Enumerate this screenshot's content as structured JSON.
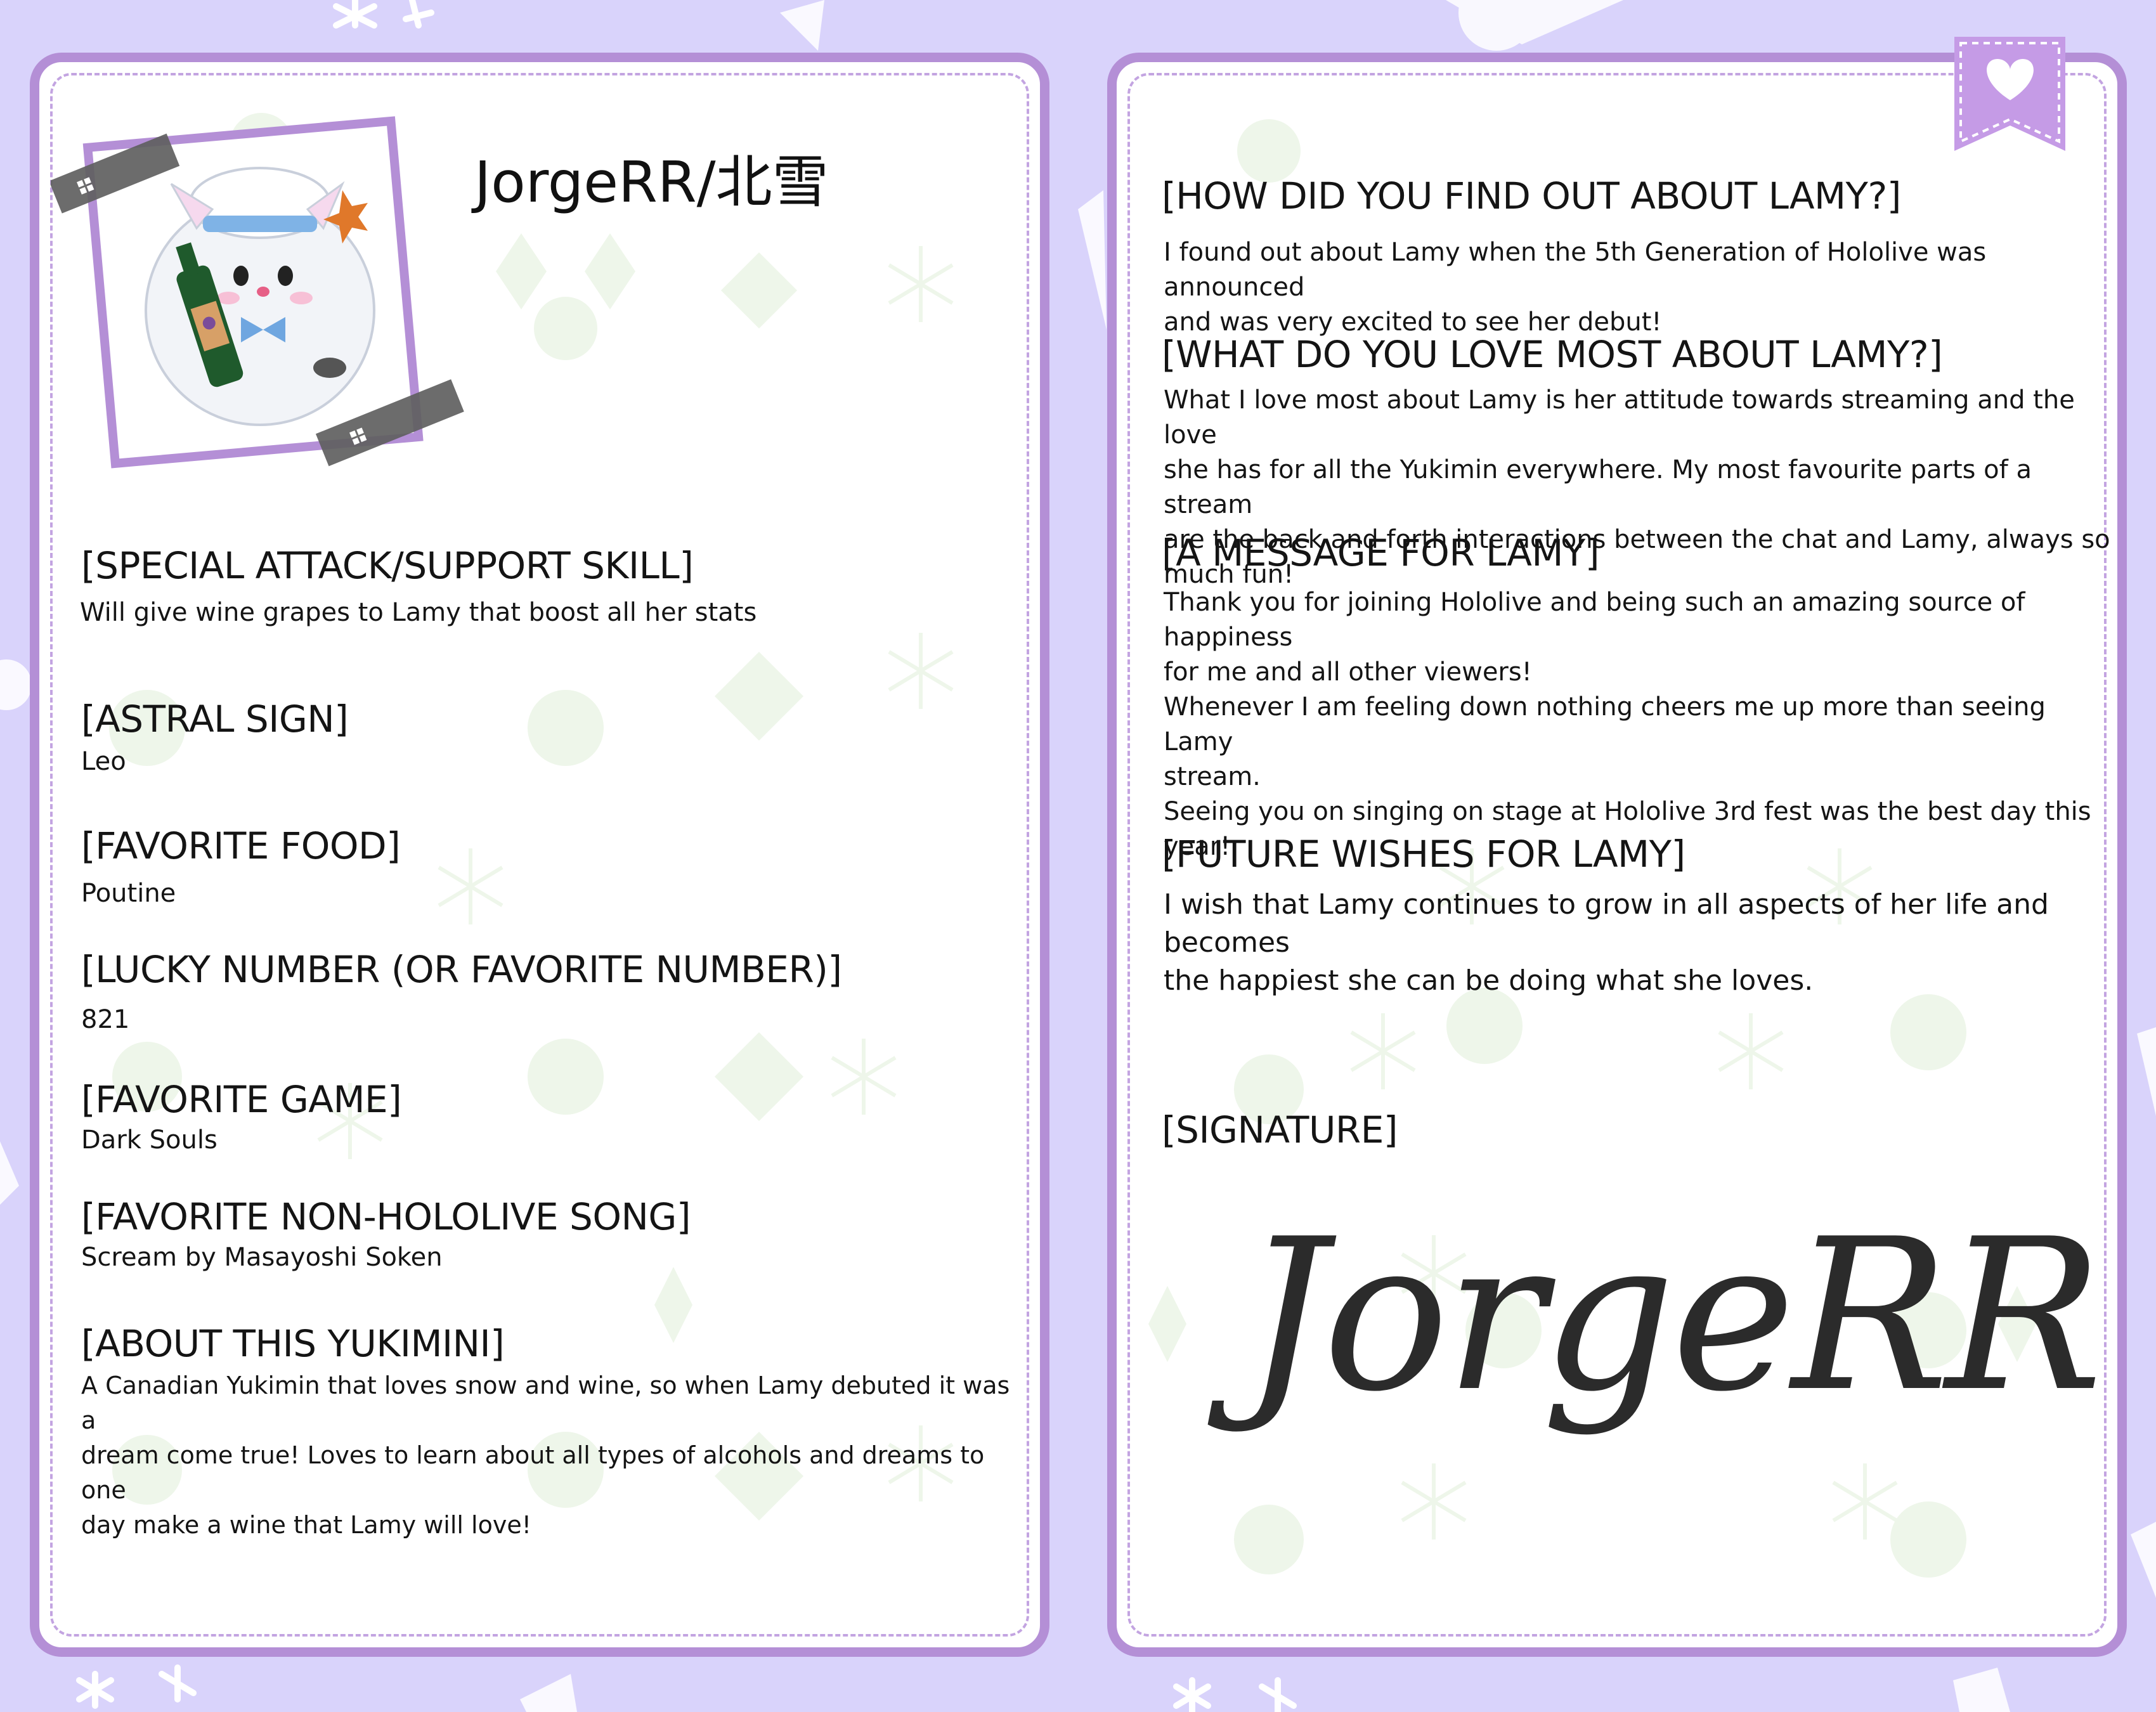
{
  "colors": {
    "background": "#d9d3fb",
    "card_border": "#b48fd6",
    "card_dash": "#c3a4e1",
    "pattern": "#eef6ea",
    "text": "#141414"
  },
  "left_card": {
    "name": "JorgeRR/北雪",
    "avatar": "chibi-lamy-snow-creature-with-wine-bottle",
    "sections": [
      {
        "heading": "[SPECIAL ATTACK/SUPPORT SKILL]",
        "value": "Will give wine grapes to Lamy that boost all her stats"
      },
      {
        "heading": "[ASTRAL SIGN]",
        "value": "Leo"
      },
      {
        "heading": "[FAVORITE FOOD]",
        "value": "Poutine"
      },
      {
        "heading": "[LUCKY NUMBER (OR FAVORITE NUMBER)]",
        "value": "821"
      },
      {
        "heading": "[FAVORITE GAME]",
        "value": "Dark Souls"
      },
      {
        "heading": "[FAVORITE NON-HOLOLIVE SONG]",
        "value": "Scream by Masayoshi Soken"
      }
    ],
    "about": {
      "heading": "[ABOUT THIS YUKIMINI]",
      "text": "A Canadian Yukimin that loves snow and wine, so when Lamy debuted it was a\ndream come true! Loves to learn about all types of alcohols and dreams to one\nday make a wine that Lamy will love!"
    }
  },
  "right_card": {
    "ribbon_icon": "heart-icon",
    "q1": {
      "heading": "[HOW DID YOU FIND OUT ABOUT LAMY?]",
      "text": "I found out about Lamy when the 5th Generation of Hololive was announced\nand was very excited to see her debut!"
    },
    "q2": {
      "heading": "[WHAT DO YOU LOVE MOST ABOUT LAMY?]",
      "text": "What I love most about Lamy is her attitude towards streaming and the love\nshe has for all the Yukimin everywhere. My most favourite parts of a stream\nare the back and forth interactions between the chat and Lamy, always so\nmuch fun!"
    },
    "q3": {
      "heading": "[A MESSAGE FOR LAMY]",
      "text": "Thank you for joining Hololive and being such an amazing source of happiness\nfor me and all other viewers!\nWhenever I am feeling down nothing cheers me up more than seeing Lamy\nstream.\nSeeing you on singing on stage at Hololive 3rd fest was the best day this year!"
    },
    "q4": {
      "heading": "[FUTURE WISHES FOR LAMY]",
      "text": "I wish that Lamy continues to grow in all aspects of her life and becomes\nthe happiest she can be doing what she loves."
    },
    "signature_heading": "[SIGNATURE]",
    "signature": "JorgeRR"
  }
}
